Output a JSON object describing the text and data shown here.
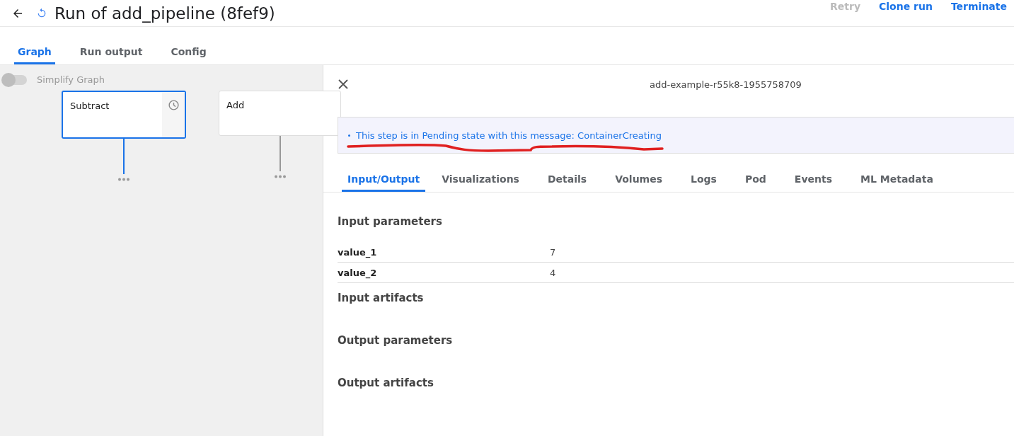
{
  "header": {
    "title": "Run of add_pipeline (8fef9)",
    "actions": [
      {
        "label": "Retry",
        "disabled": true
      },
      {
        "label": "Clone run",
        "disabled": false
      },
      {
        "label": "Terminate",
        "disabled": false
      }
    ]
  },
  "tabs": [
    {
      "label": "Graph",
      "selected": true
    },
    {
      "label": "Run output",
      "selected": false
    },
    {
      "label": "Config",
      "selected": false
    }
  ],
  "graph": {
    "simplify_toggle": {
      "label": "Simplify Graph",
      "on": false
    },
    "nodes": [
      {
        "label": "Subtract",
        "selected": true,
        "pending": true
      },
      {
        "label": "Add",
        "selected": false,
        "pending": false
      }
    ]
  },
  "details_panel": {
    "title": "add-example-r55k8-1955758709",
    "message": "This step is in Pending state with this message: ContainerCreating",
    "tabs": [
      {
        "label": "Input/Output",
        "selected": true
      },
      {
        "label": "Visualizations",
        "selected": false
      },
      {
        "label": "Details",
        "selected": false
      },
      {
        "label": "Volumes",
        "selected": false
      },
      {
        "label": "Logs",
        "selected": false
      },
      {
        "label": "Pod",
        "selected": false
      },
      {
        "label": "Events",
        "selected": false
      },
      {
        "label": "ML Metadata",
        "selected": false
      }
    ],
    "sections": [
      {
        "title": "Input parameters",
        "rows": [
          {
            "name": "value_1",
            "value": "7"
          },
          {
            "name": "value_2",
            "value": "4"
          }
        ]
      },
      {
        "title": "Input artifacts"
      },
      {
        "title": "Output parameters"
      },
      {
        "title": "Output artifacts"
      }
    ]
  }
}
